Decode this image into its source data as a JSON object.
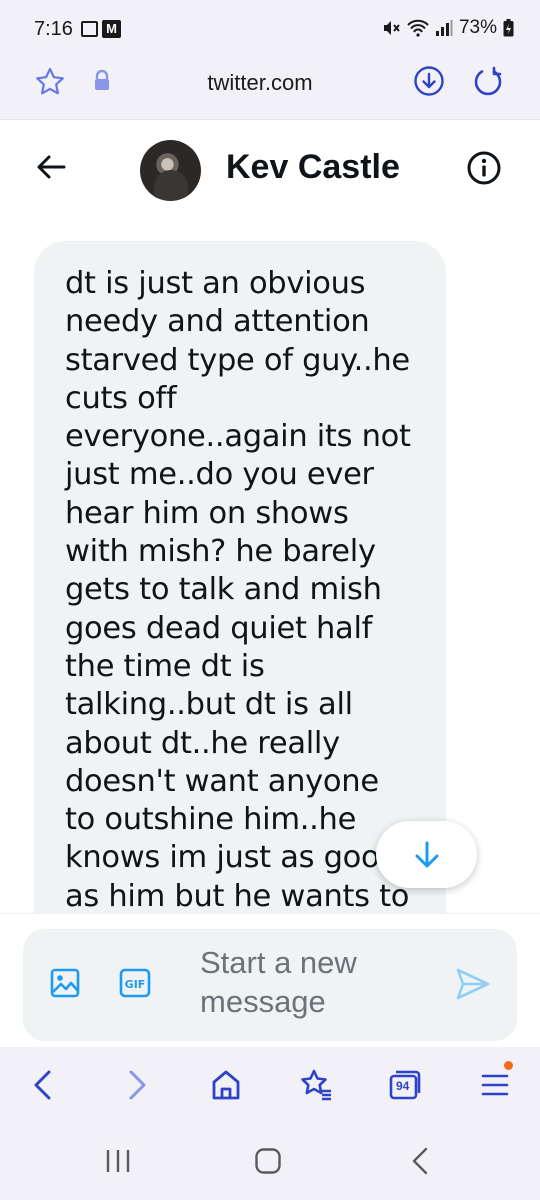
{
  "status_bar": {
    "time": "7:16",
    "battery": "73%",
    "notification_icons": [
      "image-icon",
      "gmail-icon"
    ],
    "system_icons": [
      "mute-icon",
      "wifi-icon",
      "signal-icon",
      "battery-icon"
    ]
  },
  "browser": {
    "url": "twitter.com",
    "bottom_nav": {
      "tab_count": "94",
      "items": [
        "back-icon",
        "forward-icon",
        "home-icon",
        "bookmarks-icon",
        "tabs-icon",
        "menu-icon"
      ]
    }
  },
  "chat": {
    "contact_name": "Kev Castle",
    "message": "dt is just an obvious\nneedy and attention\nstarved type of guy..he\ncuts off\neveryone..again its not\njust me..do you ever\nhear him on shows\nwith mish? he barely\ngets to talk and mish\ngoes dead quiet half\nthe time dt is\ntalking..but dt is all\nabout dt..he really\ndoesn't want anyone\nto outshine him..he\nknows im just as good\nas him but he wants to"
  },
  "composer": {
    "placeholder": "Start a new\nmessage",
    "gif_label": "GIF"
  },
  "colors": {
    "twitter_blue": "#1d9bf0",
    "browser_accent": "#2f43c8",
    "bubble_bg": "#eff3f4",
    "notification_dot": "#f26b1d"
  }
}
